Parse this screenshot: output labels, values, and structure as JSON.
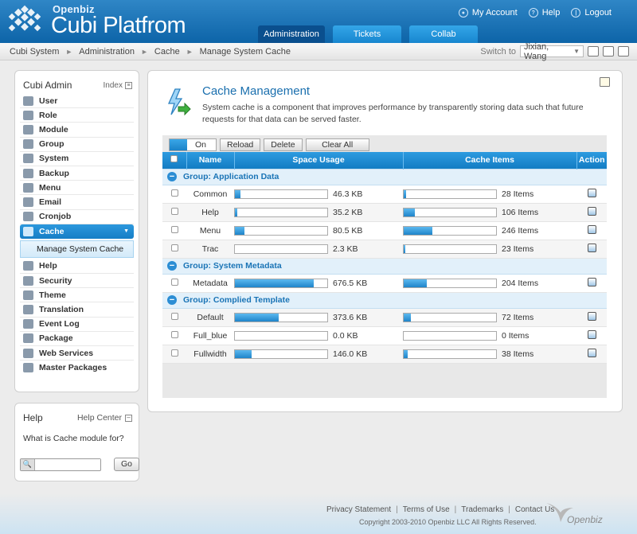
{
  "header": {
    "brand_small": "Openbiz",
    "brand_big": "Cubi Platfrom",
    "links": [
      {
        "label": "My Account",
        "icon": "user-icon"
      },
      {
        "label": "Help",
        "icon": "help-icon"
      },
      {
        "label": "Logout",
        "icon": "power-icon"
      }
    ],
    "tabs": [
      {
        "label": "Administration",
        "active": true
      },
      {
        "label": "Tickets",
        "active": false
      },
      {
        "label": "Collab",
        "active": false
      }
    ]
  },
  "breadcrumb": [
    "Cubi System",
    "Administration",
    "Cache",
    "Manage System Cache"
  ],
  "switch_to": {
    "label": "Switch to",
    "value": "Jixian, Wang"
  },
  "sidebar": {
    "title": "Cubi Admin",
    "index_label": "Index",
    "items": [
      {
        "label": "User"
      },
      {
        "label": "Role"
      },
      {
        "label": "Module"
      },
      {
        "label": "Group"
      },
      {
        "label": "System"
      },
      {
        "label": "Backup"
      },
      {
        "label": "Menu"
      },
      {
        "label": "Email"
      },
      {
        "label": "Cronjob"
      },
      {
        "label": "Cache"
      }
    ],
    "sub_item": "Manage System Cache",
    "items_after": [
      {
        "label": "Help"
      },
      {
        "label": "Security"
      },
      {
        "label": "Theme"
      },
      {
        "label": "Translation"
      },
      {
        "label": "Event Log"
      },
      {
        "label": "Package"
      },
      {
        "label": "Web Services"
      },
      {
        "label": "Master Packages"
      }
    ]
  },
  "help": {
    "title": "Help",
    "center_label": "Help Center",
    "question": "What is Cache module for?",
    "search_value": "",
    "go_label": "Go"
  },
  "main": {
    "title": "Cache Management",
    "description": "System cache is a component that improves performance by transparently storing data such that future requests for that data can be served faster.",
    "toolbar": {
      "on": "On",
      "reload": "Reload",
      "delete": "Delete",
      "clear_all": "Clear All"
    },
    "columns": {
      "name": "Name",
      "space": "Space Usage",
      "items": "Cache Items",
      "action": "Action"
    },
    "groups": [
      {
        "title": "Group: Application Data",
        "rows": [
          {
            "name": "Common",
            "space": "46.3 KB",
            "space_pct": 6,
            "items": "28 Items",
            "items_pct": 3
          },
          {
            "name": "Help",
            "space": "35.2 KB",
            "space_pct": 3,
            "items": "106 Items",
            "items_pct": 12
          },
          {
            "name": "Menu",
            "space": "80.5 KB",
            "space_pct": 10,
            "items": "246 Items",
            "items_pct": 31
          },
          {
            "name": "Trac",
            "space": "2.3 KB",
            "space_pct": 0,
            "items": "23 Items",
            "items_pct": 2
          }
        ]
      },
      {
        "title": "Group: System Metadata",
        "rows": [
          {
            "name": "Metadata",
            "space": "676.5 KB",
            "space_pct": 85,
            "items": "204 Items",
            "items_pct": 25
          }
        ]
      },
      {
        "title": "Group: Complied Template",
        "rows": [
          {
            "name": "Default",
            "space": "373.6 KB",
            "space_pct": 47,
            "items": "72 Items",
            "items_pct": 8
          },
          {
            "name": "Full_blue",
            "space": "0.0 KB",
            "space_pct": 0,
            "items": "0 Items",
            "items_pct": 0
          },
          {
            "name": "Fullwidth",
            "space": "146.0 KB",
            "space_pct": 18,
            "items": "38 Items",
            "items_pct": 4
          }
        ]
      }
    ]
  },
  "footer": {
    "links": [
      "Privacy Statement",
      "Terms of Use",
      "Trademarks",
      "Contact Us"
    ],
    "copyright": "Copyright 2003-2010 Openbiz LLC All Rights Reserved.",
    "logo_text": "Openbiz"
  }
}
